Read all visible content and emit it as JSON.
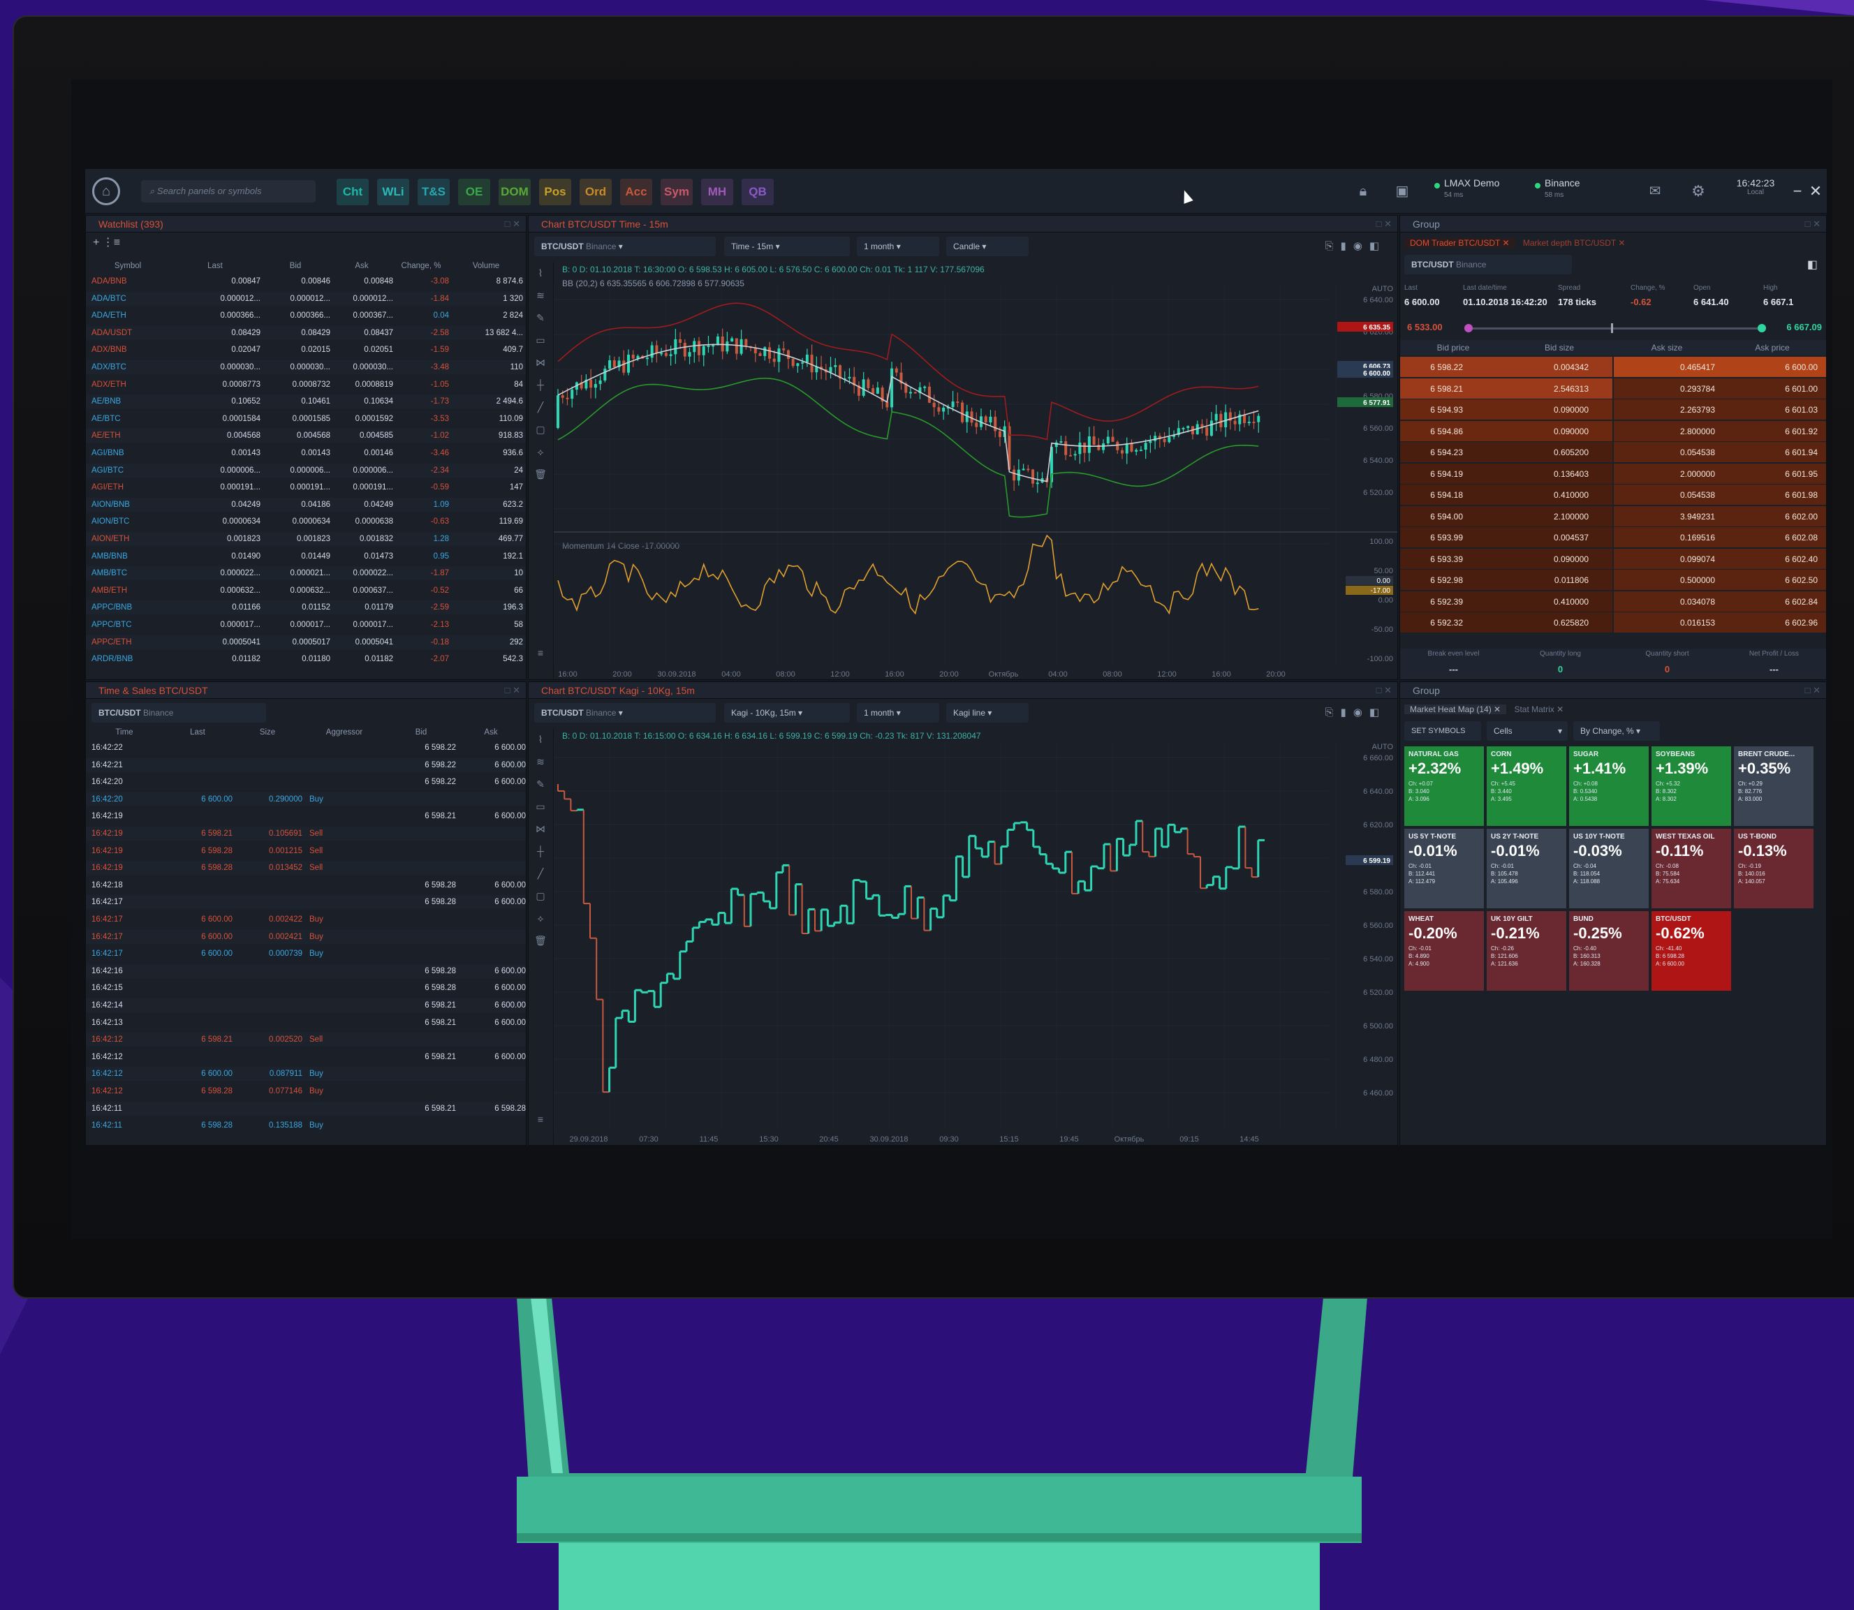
{
  "topbar": {
    "search_placeholder": "Search panels or symbols",
    "panel_buttons": [
      {
        "label": "Cht",
        "color": "#1fb8a8"
      },
      {
        "label": "WLi",
        "color": "#2fb8b8"
      },
      {
        "label": "T&S",
        "color": "#2aa8b0"
      },
      {
        "label": "OE",
        "color": "#3aa84a"
      },
      {
        "label": "DOM",
        "color": "#5aa83a"
      },
      {
        "label": "Pos",
        "color": "#c8a02a"
      },
      {
        "label": "Ord",
        "color": "#c88a2a"
      },
      {
        "label": "Acc",
        "color": "#c85a3a"
      },
      {
        "label": "Sym",
        "color": "#c85a6a"
      },
      {
        "label": "MH",
        "color": "#a05ab8"
      },
      {
        "label": "QB",
        "color": "#8a5ac8"
      }
    ],
    "connection_1": "LMAX Demo",
    "connection_1_sub": "54 ms",
    "connection_2": "Binance",
    "connection_2_sub": "58 ms",
    "time": "16:42:23",
    "time_sub": "Local"
  },
  "watchlist": {
    "title": "Watchlist (393)",
    "columns": [
      "Symbol",
      "Last",
      "Bid",
      "Ask",
      "Change, %",
      "Volume"
    ],
    "rows": [
      [
        "ADA/BNB",
        "0.00847",
        "0.00846",
        "0.00848",
        "-3.08",
        "8 874.6"
      ],
      [
        "ADA/BTC",
        "0.000012...",
        "0.000012...",
        "0.000012...",
        "-1.84",
        "1 320"
      ],
      [
        "ADA/ETH",
        "0.000366...",
        "0.000366...",
        "0.000367...",
        "0.04",
        "2 824"
      ],
      [
        "ADA/USDT",
        "0.08429",
        "0.08429",
        "0.08437",
        "-2.58",
        "13 682 4..."
      ],
      [
        "ADX/BNB",
        "0.02047",
        "0.02015",
        "0.02051",
        "-1.59",
        "409.7"
      ],
      [
        "ADX/BTC",
        "0.000030...",
        "0.000030...",
        "0.000030...",
        "-3.48",
        "110"
      ],
      [
        "ADX/ETH",
        "0.0008773",
        "0.0008732",
        "0.0008819",
        "-1.05",
        "84"
      ],
      [
        "AE/BNB",
        "0.10652",
        "0.10461",
        "0.10634",
        "-1.73",
        "2 494.6"
      ],
      [
        "AE/BTC",
        "0.0001584",
        "0.0001585",
        "0.0001592",
        "-3.53",
        "110.09"
      ],
      [
        "AE/ETH",
        "0.004568",
        "0.004568",
        "0.004585",
        "-1.02",
        "918.83"
      ],
      [
        "AGI/BNB",
        "0.00143",
        "0.00143",
        "0.00146",
        "-3.46",
        "936.6"
      ],
      [
        "AGI/BTC",
        "0.000006...",
        "0.000006...",
        "0.000006...",
        "-2.34",
        "24"
      ],
      [
        "AGI/ETH",
        "0.000191...",
        "0.000191...",
        "0.000191...",
        "-0.59",
        "147"
      ],
      [
        "AION/BNB",
        "0.04249",
        "0.04186",
        "0.04249",
        "1.09",
        "623.2"
      ],
      [
        "AION/BTC",
        "0.0000634",
        "0.0000634",
        "0.0000638",
        "-0.63",
        "119.69"
      ],
      [
        "AION/ETH",
        "0.001823",
        "0.001823",
        "0.001832",
        "1.28",
        "469.77"
      ],
      [
        "AMB/BNB",
        "0.01490",
        "0.01449",
        "0.01473",
        "0.95",
        "192.1"
      ],
      [
        "AMB/BTC",
        "0.000022...",
        "0.000021...",
        "0.000022...",
        "-1.87",
        "10"
      ],
      [
        "AMB/ETH",
        "0.000632...",
        "0.000632...",
        "0.000637...",
        "-0.52",
        "66"
      ],
      [
        "APPC/BNB",
        "0.01166",
        "0.01152",
        "0.01179",
        "-2.59",
        "196.3"
      ],
      [
        "APPC/BTC",
        "0.000017...",
        "0.000017...",
        "0.000017...",
        "-2.13",
        "58"
      ],
      [
        "APPC/ETH",
        "0.0005041",
        "0.0005017",
        "0.0005041",
        "-0.18",
        "292"
      ],
      [
        "ARDR/BNB",
        "0.01182",
        "0.01180",
        "0.01182",
        "-2.07",
        "542.3"
      ]
    ]
  },
  "chart1": {
    "title": "Chart BTC/USDT Time - 15m",
    "symbol": "BTC/USDT",
    "symbol_sub": "Binance",
    "aggregation": "Time - 15m",
    "range": "1 month",
    "style": "Candle",
    "ohlc": "B: 0      D: 01.10.2018   T: 16:30:00   O: 6 598.53   H: 6 605.00   L: 6 576.50   C: 6 600.00   Ch: 0.01   Tk: 1 117   V: 177.567096",
    "indicator": "BB (20,2)  6 635.35565  6 606.72898  6 577.90635",
    "sub_indicator": "Momentum 14 Close  -17.00000",
    "auto_label": "AUTO",
    "price_labels": [
      "6 640.00",
      "6 620.00",
      "6 600.00",
      "6 580.00",
      "6 560.00",
      "6 540.00",
      "6 520.00"
    ],
    "highlight_prices": [
      "6 635.35",
      "6 606.73",
      "6 600.00",
      "6 577.91"
    ],
    "sub_labels": [
      "100.00",
      "50.00",
      "0.00",
      "-50.00",
      "-100.00"
    ],
    "sub_highlight": [
      "0.00",
      "-17.00"
    ],
    "time_labels": [
      "16:00",
      "20:00",
      "30.09.2018",
      "04:00",
      "08:00",
      "12:00",
      "16:00",
      "20:00",
      "Октябрь",
      "04:00",
      "08:00",
      "12:00",
      "16:00",
      "20:00"
    ]
  },
  "dom": {
    "title": "Group",
    "tab1": "DOM Trader BTC/USDT",
    "tab2": "Market depth BTC/USDT",
    "symbol": "BTC/USDT",
    "symbol_sub": "Binance",
    "stat_labels": [
      "Last",
      "Last date/time",
      "Spread",
      "Change, %",
      "Open",
      "High"
    ],
    "stat_values": [
      "6 600.00",
      "01.10.2018 16:42:20",
      "178 ticks",
      "-0.62",
      "6 641.40",
      "6 667.1"
    ],
    "range_low": "6 533.00",
    "range_high": "6 667.09",
    "columns": [
      "Bid price",
      "Bid size",
      "Ask size",
      "Ask price"
    ],
    "rows": [
      [
        "6 598.22",
        "0.004342",
        "0.465417",
        "6 600.00"
      ],
      [
        "6 598.21",
        "2.546313",
        "0.293784",
        "6 601.00"
      ],
      [
        "6 594.93",
        "0.090000",
        "2.263793",
        "6 601.03"
      ],
      [
        "6 594.86",
        "0.090000",
        "2.800000",
        "6 601.92"
      ],
      [
        "6 594.23",
        "0.605200",
        "0.054538",
        "6 601.94"
      ],
      [
        "6 594.19",
        "0.136403",
        "2.000000",
        "6 601.95"
      ],
      [
        "6 594.18",
        "0.410000",
        "0.054538",
        "6 601.98"
      ],
      [
        "6 594.00",
        "2.100000",
        "3.949231",
        "6 602.00"
      ],
      [
        "6 593.99",
        "0.004537",
        "0.169516",
        "6 602.08"
      ],
      [
        "6 593.39",
        "0.090000",
        "0.099074",
        "6 602.40"
      ],
      [
        "6 592.98",
        "0.011806",
        "0.500000",
        "6 602.50"
      ],
      [
        "6 592.39",
        "0.410000",
        "0.034078",
        "6 602.84"
      ],
      [
        "6 592.32",
        "0.625820",
        "0.016153",
        "6 602.96"
      ]
    ],
    "footer_labels": [
      "Break even level",
      "Quantity long",
      "Quantity short",
      "Net Profit / Loss"
    ],
    "footer_values": [
      "---",
      "0",
      "0",
      "---"
    ]
  },
  "timesales": {
    "title": "Time & Sales BTC/USDT",
    "symbol": "BTC/USDT",
    "symbol_sub": "Binance",
    "columns": [
      "Time",
      "Last",
      "Size",
      "Aggressor",
      "Bid",
      "Ask"
    ],
    "rows": [
      [
        "16:42:22",
        "",
        "",
        "",
        "6 598.22",
        "6 600.00",
        "w"
      ],
      [
        "16:42:21",
        "",
        "",
        "",
        "6 598.22",
        "6 600.00",
        "w"
      ],
      [
        "16:42:20",
        "",
        "",
        "",
        "6 598.22",
        "6 600.00",
        "w"
      ],
      [
        "16:42:20",
        "6 600.00",
        "0.290000",
        "Buy",
        "",
        "",
        "b"
      ],
      [
        "16:42:19",
        "",
        "",
        "",
        "6 598.21",
        "6 600.00",
        "w"
      ],
      [
        "16:42:19",
        "6 598.21",
        "0.105691",
        "Sell",
        "",
        "",
        "s"
      ],
      [
        "16:42:19",
        "6 598.28",
        "0.001215",
        "Sell",
        "",
        "",
        "s"
      ],
      [
        "16:42:19",
        "6 598.28",
        "0.013452",
        "Sell",
        "",
        "",
        "s"
      ],
      [
        "16:42:18",
        "",
        "",
        "",
        "6 598.28",
        "6 600.00",
        "w"
      ],
      [
        "16:42:17",
        "",
        "",
        "",
        "6 598.28",
        "6 600.00",
        "w"
      ],
      [
        "16:42:17",
        "6 600.00",
        "0.002422",
        "Buy",
        "",
        "",
        "s"
      ],
      [
        "16:42:17",
        "6 600.00",
        "0.002421",
        "Buy",
        "",
        "",
        "s"
      ],
      [
        "16:42:17",
        "6 600.00",
        "0.000739",
        "Buy",
        "",
        "",
        "b"
      ],
      [
        "16:42:16",
        "",
        "",
        "",
        "6 598.28",
        "6 600.00",
        "w"
      ],
      [
        "16:42:15",
        "",
        "",
        "",
        "6 598.28",
        "6 600.00",
        "w"
      ],
      [
        "16:42:14",
        "",
        "",
        "",
        "6 598.21",
        "6 600.00",
        "w"
      ],
      [
        "16:42:13",
        "",
        "",
        "",
        "6 598.21",
        "6 600.00",
        "w"
      ],
      [
        "16:42:12",
        "6 598.21",
        "0.002520",
        "Sell",
        "",
        "",
        "s"
      ],
      [
        "16:42:12",
        "",
        "",
        "",
        "6 598.21",
        "6 600.00",
        "w"
      ],
      [
        "16:42:12",
        "6 600.00",
        "0.087911",
        "Buy",
        "",
        "",
        "b"
      ],
      [
        "16:42:12",
        "6 598.28",
        "0.077146",
        "Buy",
        "",
        "",
        "s"
      ],
      [
        "16:42:11",
        "",
        "",
        "",
        "6 598.21",
        "6 598.28",
        "w"
      ],
      [
        "16:42:11",
        "6 598.28",
        "0.135188",
        "Buy",
        "",
        "",
        "b"
      ]
    ]
  },
  "chart2": {
    "title": "Chart BTC/USDT Kagi - 10Kg, 15m",
    "symbol": "BTC/USDT",
    "symbol_sub": "Binance",
    "aggregation": "Kagi - 10Kg, 15m",
    "range": "1 month",
    "style": "Kagi line",
    "ohlc": "B: 0      D: 01.10.2018   T: 16:15:00   O: 6 634.16   H: 6 634.16   L: 6 599.19   C: 6 599.19   Ch: -0.23   Tk: 817     V: 131.208047",
    "auto_label": "AUTO",
    "price_labels": [
      "6 660.00",
      "6 640.00",
      "6 620.00",
      "6 600.00",
      "6 580.00",
      "6 560.00",
      "6 540.00",
      "6 520.00",
      "6 500.00",
      "6 480.00",
      "6 460.00"
    ],
    "highlight_price": "6 599.19",
    "time_labels": [
      "29.09.2018",
      "07:30",
      "11:45",
      "15:30",
      "20:45",
      "30.09.2018",
      "09:30",
      "15:15",
      "19:45",
      "Октябрь",
      "09:15",
      "14:45"
    ]
  },
  "heatmap": {
    "title": "Group",
    "tab1": "Market Heat Map (14)",
    "tab2": "Stat Matrix",
    "set_symbols": "SET SYMBOLS",
    "view": "Cells",
    "sort": "By Change, %",
    "cells": [
      {
        "name": "NATURAL GAS",
        "value": "+2.32%",
        "color": "#1e8a3a",
        "detail": "Ch: +0.07\nB: 3.040\nA: 3.096"
      },
      {
        "name": "CORN",
        "value": "+1.49%",
        "color": "#1e8a3a",
        "detail": "Ch: +5.45\nB: 3.440\nA: 3.495"
      },
      {
        "name": "SUGAR",
        "value": "+1.41%",
        "color": "#1e8a3a",
        "detail": "Ch: +0.08\nB: 0.5340\nA: 0.5438"
      },
      {
        "name": "SOYBEANS",
        "value": "+1.39%",
        "color": "#1e8a3a",
        "detail": "Ch: +5.32\nB: 8.302\nA: 8.302"
      },
      {
        "name": "BRENT CRUDE...",
        "value": "+0.35%",
        "color": "#3a4452",
        "detail": "Ch: +0.29\nB: 82.776\nA: 83.000"
      },
      {
        "name": "US 5Y T-NOTE",
        "value": "-0.01%",
        "color": "#3a4452",
        "detail": "Ch: -0.01\nB: 112.441\nA: 112.479"
      },
      {
        "name": "US 2Y T-NOTE",
        "value": "-0.01%",
        "color": "#3a4452",
        "detail": "Ch: -0.01\nB: 105.478\nA: 105.496"
      },
      {
        "name": "US 10Y T-NOTE",
        "value": "-0.03%",
        "color": "#3a4452",
        "detail": "Ch: -0.04\nB: 118.054\nA: 118.088"
      },
      {
        "name": "WEST TEXAS OIL",
        "value": "-0.11%",
        "color": "#6a2830",
        "detail": "Ch: -0.08\nB: 75.584\nA: 75.634"
      },
      {
        "name": "US T-BOND",
        "value": "-0.13%",
        "color": "#6a2830",
        "detail": "Ch: -0.19\nB: 140.016\nA: 140.057"
      },
      {
        "name": "WHEAT",
        "value": "-0.20%",
        "color": "#6a2830",
        "detail": "Ch: -0.01\nB: 4.890\nA: 4.900"
      },
      {
        "name": "UK 10Y GILT",
        "value": "-0.21%",
        "color": "#6a2830",
        "detail": "Ch: -0.26\nB: 121.606\nA: 121.636"
      },
      {
        "name": "BUND",
        "value": "-0.25%",
        "color": "#6a2830",
        "detail": "Ch: -0.40\nB: 160.313\nA: 160.328"
      },
      {
        "name": "BTC/USDT",
        "value": "-0.62%",
        "color": "#b01515",
        "detail": "Ch: -41.40\nB: 6 598.28\nA: 6 600.00"
      }
    ]
  },
  "colors": {
    "accent_red": "#d8523a",
    "candle_up": "#2fd6b4",
    "candle_down": "#c85a40",
    "bb_upper": "#a01c1c",
    "bb_lower": "#2a9a2a",
    "momentum": "#e0a030",
    "stand": "#3fd8b8"
  }
}
